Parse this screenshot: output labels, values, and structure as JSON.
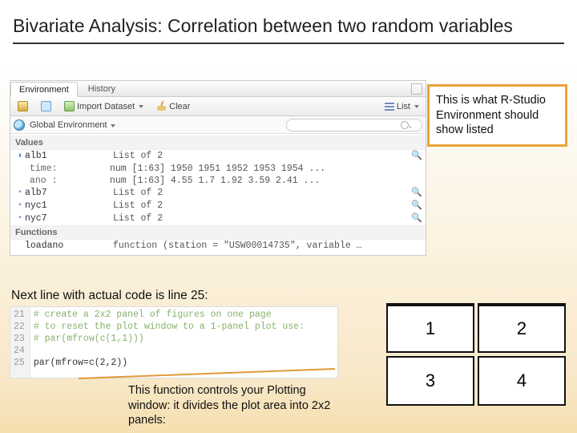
{
  "title": "Bivariate Analysis: Correlation between two random variables",
  "env": {
    "tabs": {
      "active": "Environment",
      "inactive": "History"
    },
    "toolbar": {
      "import": "Import Dataset",
      "clear": "Clear",
      "listmode": "List"
    },
    "scope": "Global Environment",
    "sections": {
      "values": "Values",
      "functions": "Functions"
    },
    "values": [
      {
        "name": "alb1",
        "desc": "List of 2",
        "expanded": true,
        "children": [
          {
            "name": "time:",
            "desc": "num [1:63] 1950 1951 1952 1953 1954 ..."
          },
          {
            "name": "ano :",
            "desc": "num [1:63] 4.55 1.7 1.92 3.59 2.41 ..."
          }
        ]
      },
      {
        "name": "alb7",
        "desc": "List of 2"
      },
      {
        "name": "nyc1",
        "desc": "List of 2"
      },
      {
        "name": "nyc7",
        "desc": "List of 2"
      }
    ],
    "functions": [
      {
        "name": "loadano",
        "desc": "function (station = \"USW00014735\", variable …"
      }
    ]
  },
  "callout": "This is what R-Studio Environment should show listed",
  "next_line": "Next line with actual code is line 25:",
  "code": {
    "lines": [
      "21",
      "22",
      "23",
      "24",
      "25"
    ],
    "l21": "# create a 2x2 panel of figures on one page",
    "l22": "# to reset the plot window to a 1-panel plot use:",
    "l23": "# par(mfrow(c(1,1)))",
    "l24": "",
    "l25": "par(mfrow=c(2,2))"
  },
  "func_note": "This function controls your Plotting window: it divides the plot area into 2x2 panels:",
  "panel_labels": {
    "a": "1",
    "b": "2",
    "c": "3",
    "d": "4"
  }
}
